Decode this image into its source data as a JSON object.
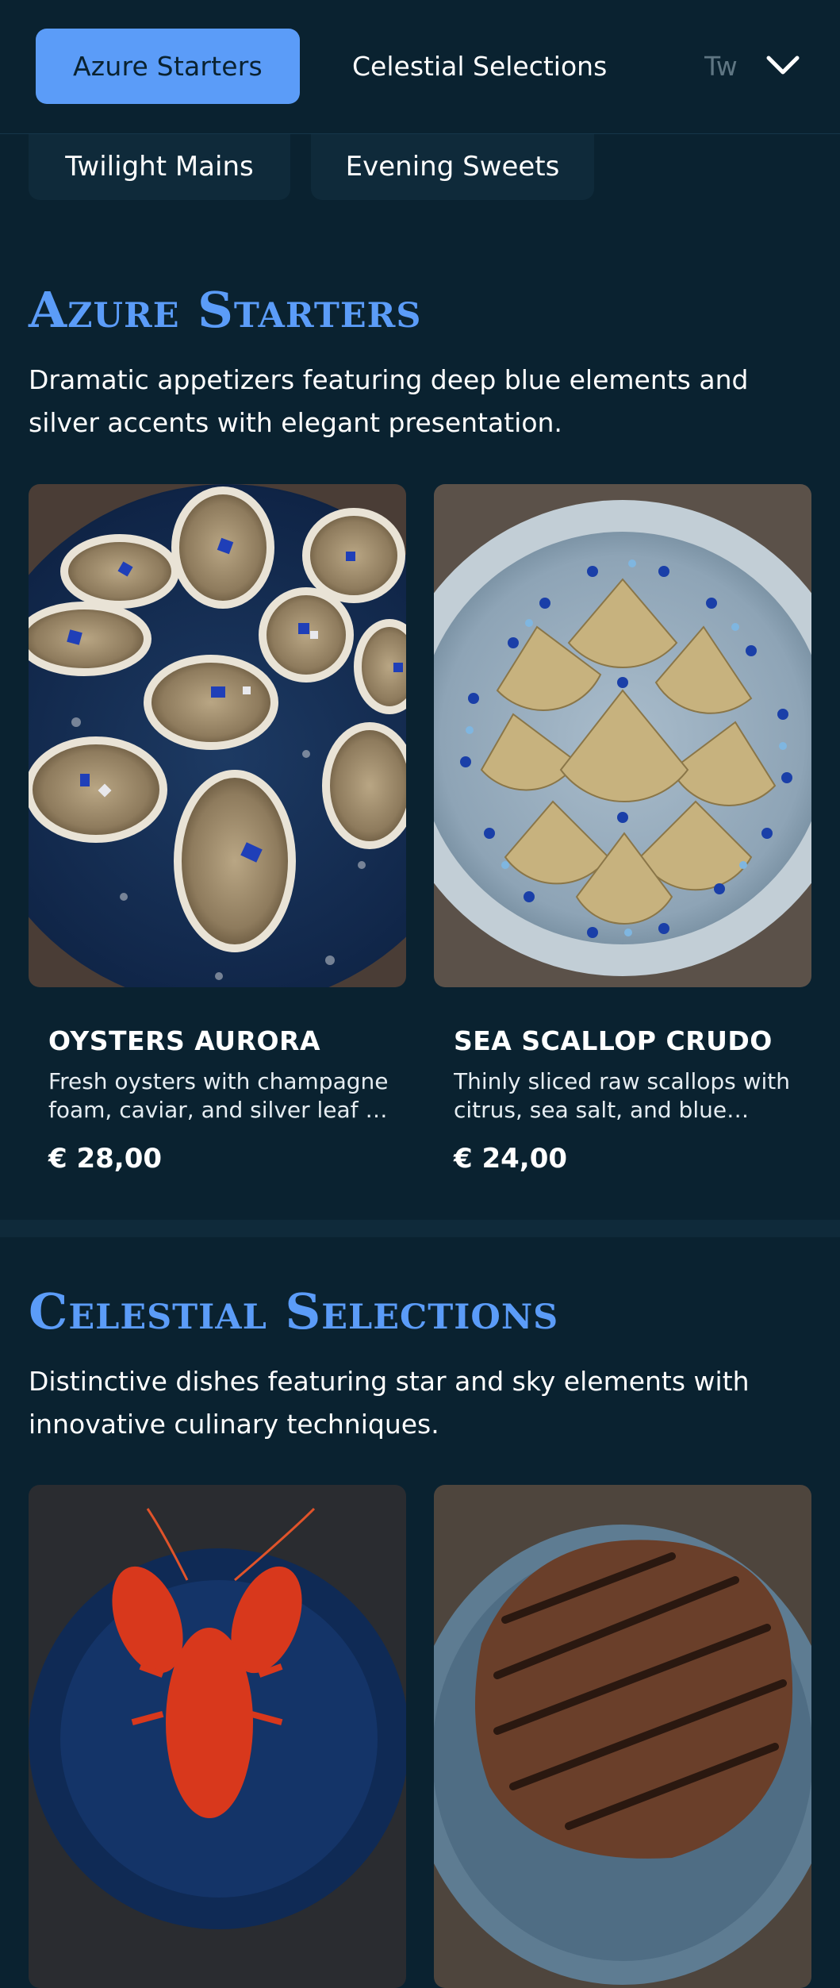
{
  "nav": {
    "tabs": [
      {
        "label": "Azure Starters",
        "active": true
      },
      {
        "label": "Celestial Selections",
        "active": false
      },
      {
        "label": "Tw",
        "active": false
      }
    ],
    "expand_icon": "chevron-down-icon"
  },
  "subnav": {
    "tabs": [
      {
        "label": "Twilight Mains"
      },
      {
        "label": "Evening Sweets"
      }
    ]
  },
  "sections": [
    {
      "title": "Azure Starters",
      "description": "Dramatic appetizers featuring deep blue elements and silver accents with elegant presentation.",
      "items": [
        {
          "name": "OYSTERS AURORA",
          "description": "Fresh oysters with champagne foam, caviar, and silver leaf on a bed of crushed ice.",
          "price": "€ 28,00"
        },
        {
          "name": "SEA SCALLOP CRUDO",
          "description": "Thinly sliced raw scallops with citrus, sea salt, and blue spirulina pearls.",
          "price": "€ 24,00"
        }
      ]
    },
    {
      "title": "Celestial Selections",
      "description": "Distinctive dishes featuring star and sky elements with innovative culinary techniques.",
      "items": [
        {
          "name": "",
          "description": "",
          "price": ""
        },
        {
          "name": "",
          "description": "",
          "price": ""
        }
      ]
    }
  ],
  "colors": {
    "background": "#0a2230",
    "accent": "#5b9cf8",
    "surface": "#0f2a3a"
  }
}
